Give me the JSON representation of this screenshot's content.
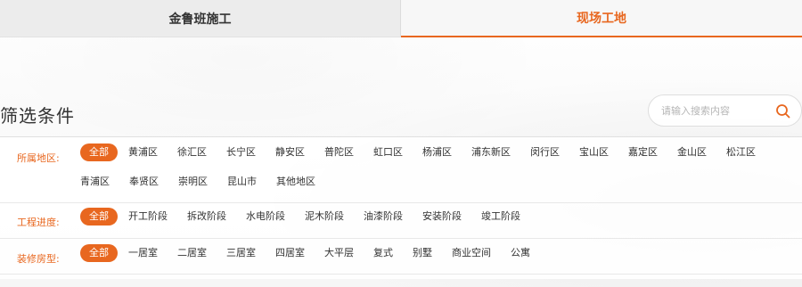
{
  "tabs": [
    {
      "label": "金鲁班施工"
    },
    {
      "label": "现场工地"
    }
  ],
  "filter_title": "筛选条件",
  "search": {
    "placeholder": "请输入搜索内容",
    "icon": "search-icon"
  },
  "filters": [
    {
      "label": "所属地区:",
      "options": [
        "全部",
        "黄浦区",
        "徐汇区",
        "长宁区",
        "静安区",
        "普陀区",
        "虹口区",
        "杨浦区",
        "浦东新区",
        "闵行区",
        "宝山区",
        "嘉定区",
        "金山区",
        "松江区",
        "青浦区",
        "奉贤区",
        "崇明区",
        "昆山市",
        "其他地区"
      ]
    },
    {
      "label": "工程进度:",
      "options": [
        "全部",
        "开工阶段",
        "拆改阶段",
        "水电阶段",
        "泥木阶段",
        "油漆阶段",
        "安装阶段",
        "竣工阶段"
      ]
    },
    {
      "label": "装修房型:",
      "options": [
        "全部",
        "一居室",
        "二居室",
        "三居室",
        "四居室",
        "大平层",
        "复式",
        "别墅",
        "商业空间",
        "公寓"
      ]
    }
  ],
  "colors": {
    "accent": "#e8671f",
    "tab_inactive_bg": "#ececec"
  }
}
